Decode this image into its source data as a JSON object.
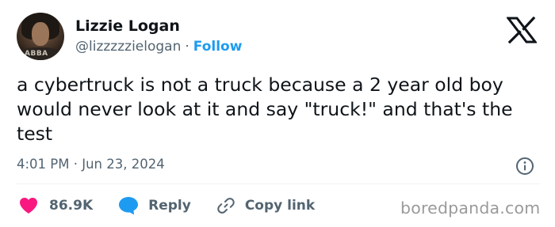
{
  "author": {
    "name": "Lizzie Logan",
    "handle": "@lizzzzzielogan",
    "separator": "·",
    "follow_label": "Follow",
    "avatar_shirt_text": "ABBA"
  },
  "brand_icon": "x-logo-icon",
  "tweet": {
    "text": "a cybertruck is not a truck because a 2 year old boy would never look at it and say \"truck!\" and that's the test",
    "timestamp": "4:01 PM · Jun 23, 2024"
  },
  "actions": {
    "like_count": "86.9K",
    "reply_label": "Reply",
    "copy_link_label": "Copy link"
  },
  "watermark": "boredpanda.com",
  "colors": {
    "text": "#0f1419",
    "secondary": "#536471",
    "accent": "#1d9bf0",
    "like": "#f91880",
    "divider": "#eff3f4"
  }
}
